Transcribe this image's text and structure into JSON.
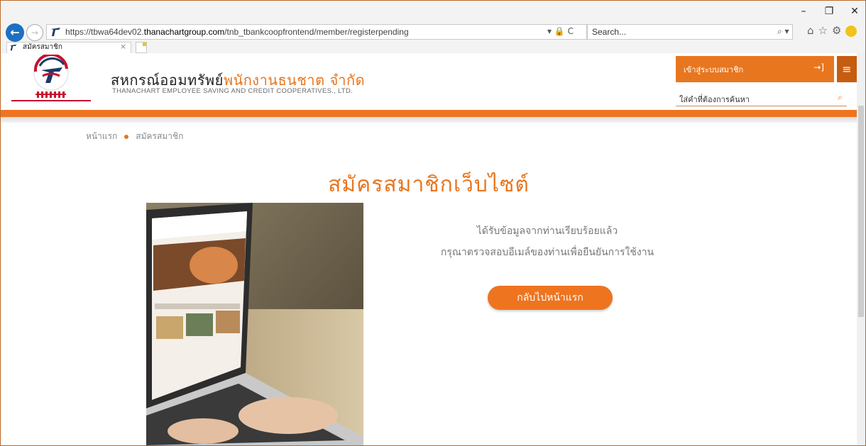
{
  "window": {
    "minimize": "–",
    "restore": "❐",
    "close": "✕"
  },
  "browser": {
    "url_prefix": "https://tbwa64dev02.",
    "url_host": "thanachartgroup.com",
    "url_path": "/tnb_tbankcoopfrontend/member/registerpending",
    "search_placeholder": "Search...",
    "tab_title": "สมัครสมาชิก",
    "tab_close": "×",
    "address_tools": "▾ 🔒 C",
    "search_tool": "⌕ ▾"
  },
  "header": {
    "brand_thai_black": "สหกรณ์ออมทรัพย์",
    "brand_thai_orange": "พนักงานธนชาต จำกัด",
    "brand_english": "THANACHART EMPLOYEE SAVING AND CREDIT COOPERATIVES., LTD.",
    "login_label": "เข้าสู่ระบบสมาชิก",
    "login_icon": "→]",
    "menu_icon": "≡",
    "search_placeholder": "ใส่คำที่ต้องการค้นหา",
    "search_icon": "⌕"
  },
  "breadcrumb": {
    "home": "หน้าแรก",
    "current": "สมัครสมาชิก"
  },
  "main": {
    "title": "สมัครสมาชิกเว็บไซต์",
    "message_line1": "ได้รับข้อมูลจากท่านเรียบร้อยแล้ว",
    "message_line2": "กรุณาตรวจสอบอีเมล์ของท่านเพื่อยืนยันการใช้งาน",
    "back_button": "กลับไปหน้าแรก"
  },
  "colors": {
    "brand_orange": "#e8761f",
    "dark_orange": "#c65c10",
    "ie_blue": "#1e6fc4"
  },
  "icons": [
    "back-arrow-icon",
    "forward-arrow-icon",
    "lock-icon",
    "refresh-icon",
    "search-icon",
    "home-icon",
    "favorites-star-icon",
    "settings-gear-icon",
    "smiley-icon",
    "login-arrow-icon",
    "hamburger-menu-icon"
  ]
}
